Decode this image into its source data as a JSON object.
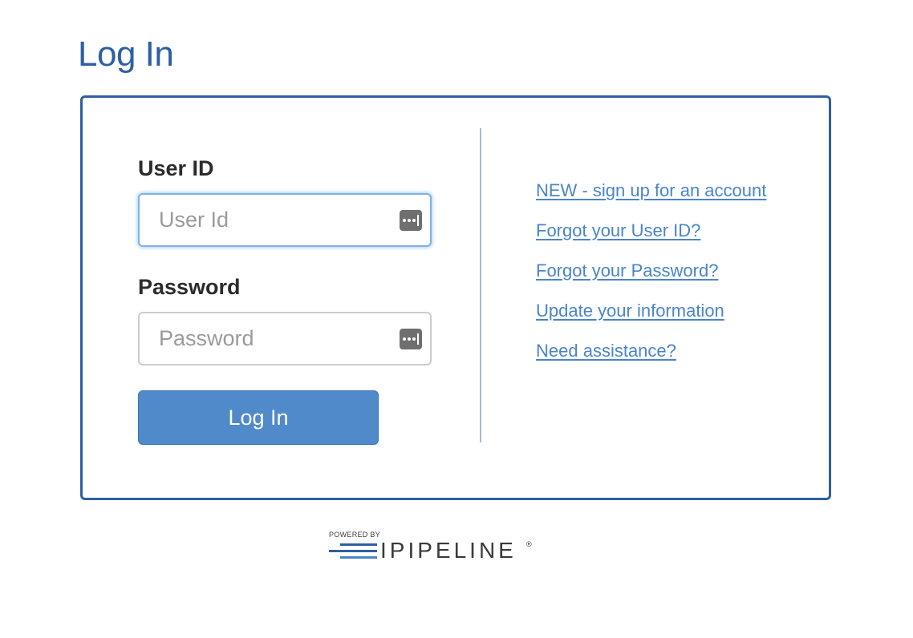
{
  "page": {
    "title": "Log In"
  },
  "form": {
    "user_id_label": "User ID",
    "user_id_placeholder": "User Id",
    "user_id_value": "",
    "password_label": "Password",
    "password_placeholder": "Password",
    "password_value": "",
    "submit_label": "Log In",
    "field_icon": "keychain-autofill-icon"
  },
  "links": [
    {
      "label": "NEW - sign up for an account"
    },
    {
      "label": "Forgot your User ID?"
    },
    {
      "label": "Forgot your Password?"
    },
    {
      "label": "Update your information"
    },
    {
      "label": "Need assistance?"
    }
  ],
  "footer": {
    "powered_by": "POWERED BY",
    "brand": "IPIPELINE",
    "registered": "®"
  },
  "colors": {
    "brand_blue": "#2e5fa3",
    "button_blue": "#508acb",
    "link_blue": "#4a84c9",
    "focus_glow": "#7fb1ea"
  }
}
